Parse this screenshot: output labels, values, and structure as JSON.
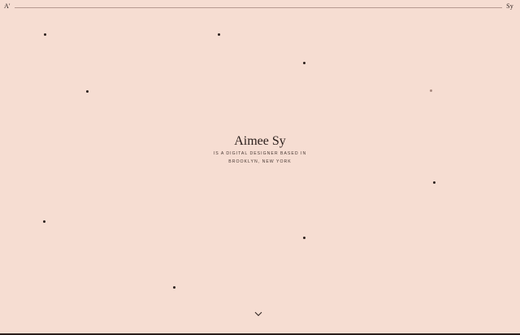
{
  "header": {
    "logo_left": "A'",
    "logo_right": "Sy"
  },
  "hero": {
    "name": "Aimee Sy",
    "tagline": "IS A DIGITAL DESIGNER BASED IN BROOKLYN, NEW YORK"
  },
  "icons": {
    "scroll_down": "chevron-down-icon"
  },
  "colors": {
    "background": "#f6ddd2",
    "text": "#2b1f1c",
    "rule": "#b79a91"
  }
}
